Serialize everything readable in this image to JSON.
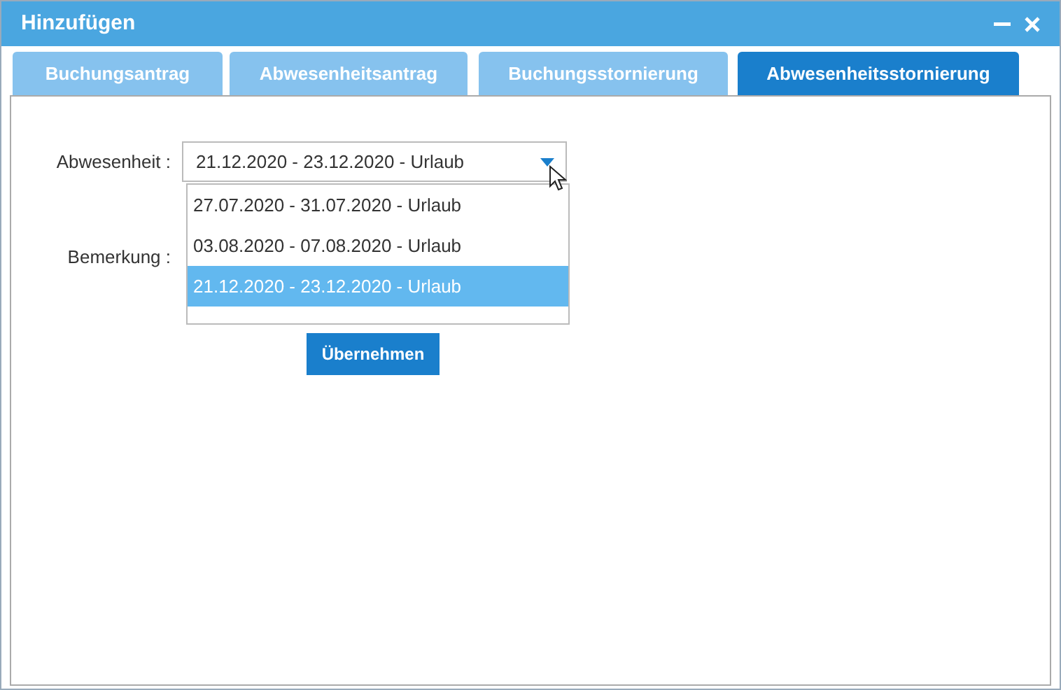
{
  "window": {
    "title": "Hinzufügen"
  },
  "tabs": [
    {
      "label": "Buchungsantrag",
      "selected": false
    },
    {
      "label": "Abwesenheitsantrag",
      "selected": false
    },
    {
      "label": "Buchungsstornierung",
      "selected": false
    },
    {
      "label": "Abwesenheitsstornierung",
      "selected": true
    }
  ],
  "form": {
    "absence_label": "Abwesenheit :",
    "absence_value": "21.12.2020 - 23.12.2020 - Urlaub",
    "dropdown_expanded": true,
    "options": [
      {
        "label": "27.07.2020 - 31.07.2020 - Urlaub",
        "selected": false
      },
      {
        "label": "03.08.2020 - 07.08.2020 - Urlaub",
        "selected": false
      },
      {
        "label": "21.12.2020 - 23.12.2020 - Urlaub",
        "selected": true
      }
    ],
    "remark_label": "Bemerkung :",
    "submit": "Übernehmen"
  }
}
